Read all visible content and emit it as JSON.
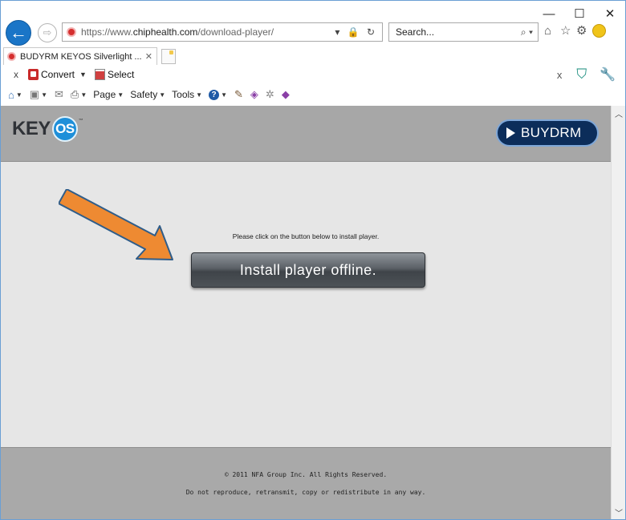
{
  "window": {
    "minimize": "—",
    "maximize": "☐",
    "close": "✕"
  },
  "address_bar": {
    "url_scheme": "https://www.",
    "url_host": "chiphealth.com",
    "url_path": "/download-player/",
    "url_actions": "▾ 🔒 ↻"
  },
  "search": {
    "placeholder": "Search...",
    "icon": "⌕ ▾"
  },
  "tab": {
    "title": "BUDYRM KEYOS Silverlight ...",
    "close": "✕"
  },
  "pdf_toolbar": {
    "close": "x",
    "convert_label": "Convert",
    "select_label": "Select",
    "right_close": "x"
  },
  "command_bar": {
    "page_label": "Page",
    "safety_label": "Safety",
    "tools_label": "Tools"
  },
  "site": {
    "logo_text": "KEY",
    "logo_badge": "OS",
    "logo_tm": "™",
    "buydrm_label": "BUYDRM"
  },
  "main": {
    "instruction": "Please click on the button below to install player.",
    "install_button": "Install player offline."
  },
  "footer": {
    "copyright": "© 2011 NFA Group Inc. All Rights Reserved.",
    "notice": "Do not reproduce, retransmit, copy or redistribute in any way."
  },
  "colors": {
    "header_bg": "#a7a7a7",
    "body_bg": "#e6e6e6",
    "arrow": "#ee8a32",
    "button": "#4d5257",
    "buydrm_bg": "#0c2d5a",
    "browser_accent": "#1a75c7"
  }
}
